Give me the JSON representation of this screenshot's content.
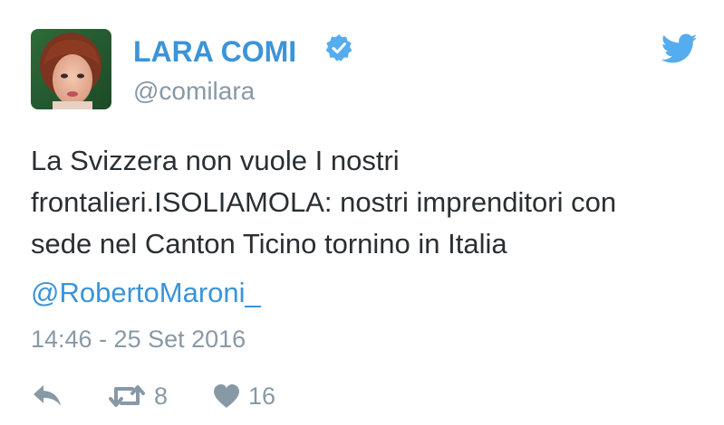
{
  "author": {
    "display_name": "LARA COMI",
    "handle": "@comilara",
    "avatar_icon": "profile-photo",
    "verified": true
  },
  "tweet": {
    "lines": [
      "La Svizzera non vuole I nostri",
      "frontalieri.ISOLIAMOLA: nostri imprenditori con",
      "sede nel Canton Ticino tornino in Italia"
    ],
    "mention": "@RobertoMaroni_",
    "timestamp": "14:46 - 25 Set 2016"
  },
  "actions": {
    "reply_icon": "reply-icon",
    "retweet_icon": "retweet-icon",
    "retweet_count": "8",
    "like_icon": "heart-icon",
    "like_count": "16"
  },
  "colors": {
    "brand_blue": "#3b94d9",
    "twitter_blue": "#55acee",
    "muted": "#8899a6",
    "text": "#292f33"
  }
}
